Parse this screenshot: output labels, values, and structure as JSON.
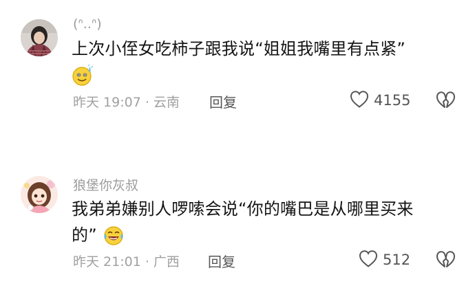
{
  "comments": [
    {
      "username": "(ᐢ..ᐢ)",
      "text": "上次小侄女吃柿子跟我说“姐姐我嘴里有点紧”",
      "emoji": "sweating-smile-emoji",
      "meta": "昨天 19:07 · 云南",
      "reply_label": "回复",
      "like_count": "4155"
    },
    {
      "username": "狼堡你灰叔",
      "text_line1": "我弟弟嫌别人啰嗦会说“你的嘴巴是从哪里买来",
      "text_line2": "的”",
      "emoji": "laughing-tears-emoji",
      "meta": "昨天 21:01 · 广西",
      "reply_label": "回复",
      "like_count": "512"
    }
  ],
  "icons": {
    "like": "heart-outline-icon",
    "dislike": "broken-heart-icon"
  }
}
